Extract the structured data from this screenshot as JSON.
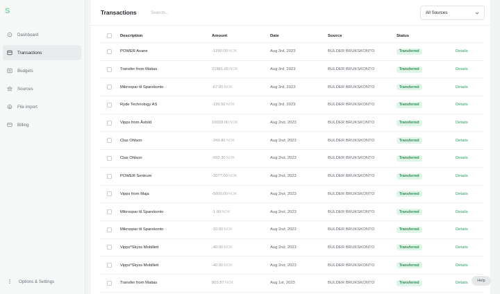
{
  "logo": {
    "glyph": "S"
  },
  "sidebar": {
    "items": [
      {
        "label": "Dashboard",
        "icon": "home-icon"
      },
      {
        "label": "Transactions",
        "icon": "card-icon",
        "active": true
      },
      {
        "label": "Budgets",
        "icon": "budget-icon"
      },
      {
        "label": "Sources",
        "icon": "bank-icon"
      },
      {
        "label": "File import",
        "icon": "file-icon"
      },
      {
        "label": "Billing",
        "icon": "billing-icon"
      }
    ],
    "settings_label": "Options & Settings"
  },
  "header": {
    "title": "Transactions",
    "search_placeholder": "Search...",
    "source_select": "All Sources"
  },
  "table": {
    "columns": {
      "description": "Description",
      "amount": "Amount",
      "date": "Date",
      "source": "Source",
      "status": "Status"
    },
    "rows": [
      {
        "description": "POWER Asane",
        "amount": "-1290.00",
        "currency": "NOK",
        "date": "Aug 3rd, 2023",
        "source": "BULDER BRUKSKONTO",
        "status": "Transferred",
        "action": "Details"
      },
      {
        "description": "Transfer from Matias",
        "amount": "21881.05",
        "currency": "NOK",
        "date": "Aug 3rd, 2023",
        "source": "BULDER BRUKSKONTO",
        "status": "Transferred",
        "action": "Details"
      },
      {
        "description": "Mikrospar til Sparekonto",
        "amount": "-67.00",
        "currency": "NOK",
        "date": "Aug 3rd, 2023",
        "source": "BULDER BRUKSKONTO",
        "status": "Transferred",
        "action": "Details"
      },
      {
        "description": "Ryde Technology AS",
        "amount": "-199.50",
        "currency": "NOK",
        "date": "Aug 3rd, 2023",
        "source": "BULDER BRUKSKONTO",
        "status": "Transferred",
        "action": "Details"
      },
      {
        "description": "Vipps from Åshild",
        "amount": "10000.00",
        "currency": "NOK",
        "date": "Aug 2nd, 2023",
        "source": "BULDER BRUKSKONTO",
        "status": "Transferred",
        "action": "Details"
      },
      {
        "description": "Clas Ohlson",
        "amount": "-349.80",
        "currency": "NOK",
        "date": "Aug 2nd, 2023",
        "source": "BULDER BRUKSKONTO",
        "status": "Transferred",
        "action": "Details"
      },
      {
        "description": "Clas Ohlson",
        "amount": "-992.30",
        "currency": "NOK",
        "date": "Aug 2nd, 2023",
        "source": "BULDER BRUKSKONTO",
        "status": "Transferred",
        "action": "Details"
      },
      {
        "description": "POWER Sentrum",
        "amount": "-2077.00",
        "currency": "NOK",
        "date": "Aug 2nd, 2023",
        "source": "BULDER BRUKSKONTO",
        "status": "Transferred",
        "action": "Details"
      },
      {
        "description": "Vipps from Maja",
        "amount": "-5000.00",
        "currency": "NOK",
        "date": "Aug 2nd, 2023",
        "source": "BULDER BRUKSKONTO",
        "status": "Transferred",
        "action": "Details"
      },
      {
        "description": "Mikrospar til Sparekonto",
        "amount": "-1.00",
        "currency": "NOK",
        "date": "Aug 2nd, 2023",
        "source": "BULDER BRUKSKONTO",
        "status": "Transferred",
        "action": "Details"
      },
      {
        "description": "Mikrospar til Sparekonto",
        "amount": "-10.00",
        "currency": "NOK",
        "date": "Aug 2nd, 2023",
        "source": "BULDER BRUKSKONTO",
        "status": "Transferred",
        "action": "Details"
      },
      {
        "description": "Vipps*Skyss Mobillett",
        "amount": "-40.00",
        "currency": "NOK",
        "date": "Aug 2nd, 2023",
        "source": "BULDER BRUKSKONTO",
        "status": "Transferred",
        "action": "Details"
      },
      {
        "description": "Vipps*Skyss Mobillett",
        "amount": "-40.00",
        "currency": "NOK",
        "date": "Aug 2nd, 2023",
        "source": "BULDER BRUKSKONTO",
        "status": "Transferred",
        "action": "Details"
      },
      {
        "description": "Transfer from Matias",
        "amount": "803.87",
        "currency": "NOK",
        "date": "Aug 1st, 2023",
        "source": "BULDER BRUKSKONTO",
        "status": "Transferred",
        "action": "Details"
      }
    ]
  },
  "help_label": "Help",
  "colors": {
    "accent": "#2f9a62",
    "badge_bg": "#dff5e7",
    "badge_text": "#2f8a55",
    "logo": "#7fd3a8"
  }
}
